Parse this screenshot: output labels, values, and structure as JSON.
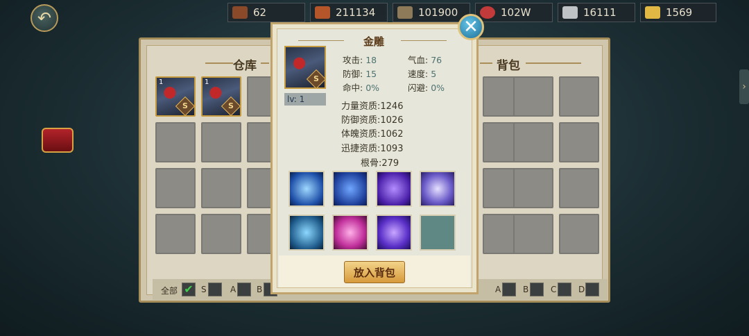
{
  "resources": [
    {
      "icon": "badge-icon",
      "value": "62"
    },
    {
      "icon": "bricks-icon",
      "value": "211134"
    },
    {
      "icon": "ingot-stack-icon",
      "value": "101900"
    },
    {
      "icon": "red-die-icon",
      "value": "102W"
    },
    {
      "icon": "silver-ingot-icon",
      "value": "16111"
    },
    {
      "icon": "gold-ingot-icon",
      "value": "1569"
    }
  ],
  "warehouse": {
    "title": "仓库",
    "slot1_count": "1",
    "slot1_grade": "S",
    "slot2_count": "1",
    "slot2_grade": "S"
  },
  "backpack": {
    "title": "背包"
  },
  "filters_left": {
    "all": "全部",
    "s": "S",
    "a": "A",
    "b": "B"
  },
  "filters_right": {
    "a": "A",
    "b": "B",
    "c": "C",
    "d": "D"
  },
  "pet": {
    "name": "金雕",
    "grade": "S",
    "level": "lv: 1",
    "stats": {
      "attack_label": "攻击:",
      "attack": "18",
      "hp_label": "气血:",
      "hp": "76",
      "defense_label": "防御:",
      "defense": "15",
      "speed_label": "速度:",
      "speed": "5",
      "hit_label": "命中:",
      "hit": "0%",
      "dodge_label": "闪避:",
      "dodge": "0%"
    },
    "aptitudes": {
      "strength": "力量资质:1246",
      "defense": "防御资质:1026",
      "physique": "体魄资质:1062",
      "agility": "迅捷资质:1093",
      "bone": "根骨:279"
    },
    "skills": [
      "lightning-skill-icon",
      "shield-skill-icon",
      "purple-slash-skill-icon",
      "vortex-skill-icon",
      "ice-spike-skill-icon",
      "pink-heart-skill-icon",
      "purple-whirl-skill-icon",
      "locked-skill-slot-icon"
    ]
  },
  "put_in_bag_label": "放入背包",
  "colors": {
    "accent": "#c0a46b",
    "button": "#e6b45e",
    "close": "#2f8fbf"
  }
}
